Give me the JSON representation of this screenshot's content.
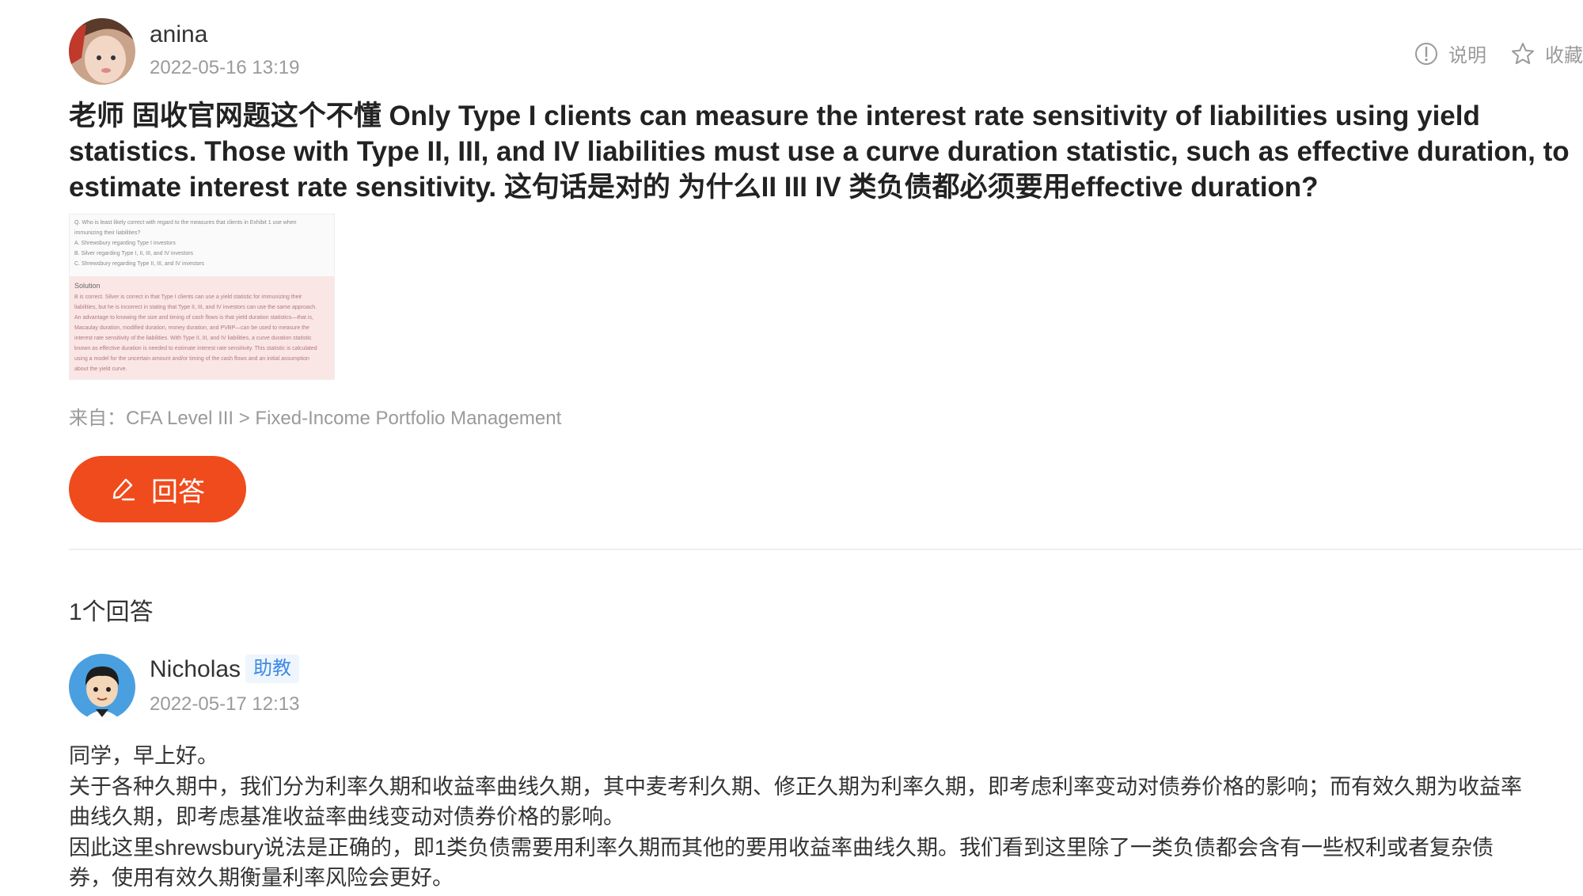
{
  "question": {
    "author": "anina",
    "timestamp": "2022-05-16 13:19",
    "text": "老师 固收官网题这个不懂 Only Type I clients can measure the interest rate sensitivity of liabilities using yield statistics. Those with Type II, III, and IV liabilities must use a curve duration statistic, such as effective duration, to estimate interest rate sensitivity. 这句话是对的 为什么II III IV 类负债都必须要用effective duration?",
    "source_prefix": "来自：",
    "source_path": "CFA Level III > Fixed-Income Portfolio Management"
  },
  "actions": {
    "explain_label": "说明",
    "favorite_label": "收藏"
  },
  "answer_button_label": "回答",
  "thumbnail": {
    "question_lines": [
      "Q. Who is least likely correct with regard to the measures that clients in Exhibit 1 use when",
      "immunizing their liabilities?",
      "A. Shrewsbury regarding Type I investors",
      "B. Silver regarding Type I, II, III, and IV investors",
      "C. Shrewsbury regarding Type II, III, and IV investors"
    ],
    "solution_heading": "Solution",
    "solution_lines": [
      "B is correct. Silver is correct in that Type I clients can use a yield statistic for immunizing their",
      "liabilities, but he is incorrect in stating that Type II, III, and IV investors can use the same approach.",
      "An advantage to knowing the size and timing of cash flows is that yield duration statistics—that is,",
      "Macaulay duration, modified duration, money duration, and PVBP—can be used to measure the",
      "interest rate sensitivity of the liabilities. With Type II, III, and IV liabilities, a curve duration statistic",
      "known as effective duration is needed to estimate interest rate sensitivity. This statistic is calculated",
      "using a model for the uncertain amount and/or timing of the cash flows and an initial assumption",
      "about the yield curve."
    ]
  },
  "answers_count_label": "1个回答",
  "answer": {
    "author": "Nicholas",
    "badge": "助教",
    "timestamp": "2022-05-17 12:13",
    "paragraphs": [
      "同学，早上好。",
      "关于各种久期中，我们分为利率久期和收益率曲线久期，其中麦考利久期、修正久期为利率久期，即考虑利率变动对债券价格的影响；而有效久期为收益率曲线久期，即考虑基准收益率曲线变动对债券价格的影响。",
      "因此这里shrewsbury说法是正确的，即1类负债需要用利率久期而其他的要用收益率曲线久期。我们看到这里除了一类负债都会含有一些权利或者复杂债券，使用有效久期衡量利率风险会更好。"
    ]
  },
  "colors": {
    "accent": "#f04b1c",
    "badge_text": "#3d8ae6",
    "badge_bg": "#eef5fd",
    "muted": "#9a9a9a"
  }
}
